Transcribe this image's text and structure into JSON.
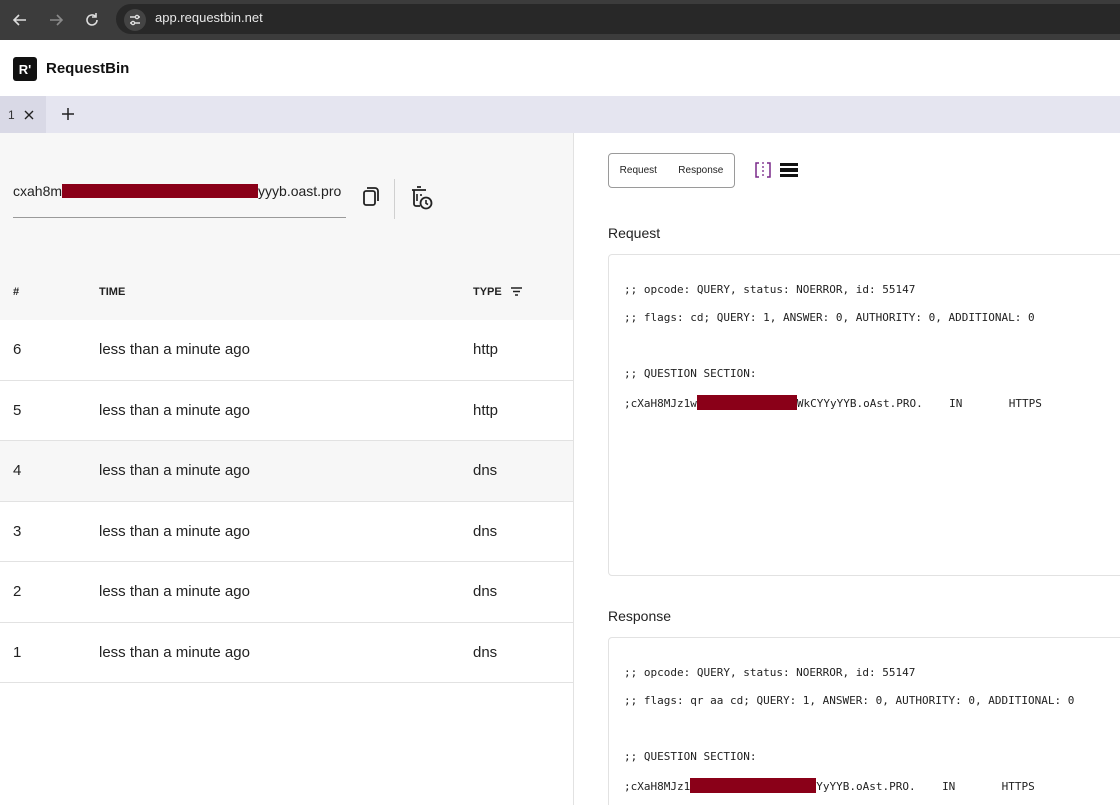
{
  "browser": {
    "url": "app.requestbin.net",
    "back_icon": "arrow-left-icon",
    "forward_icon": "arrow-right-icon",
    "reload_icon": "reload-icon",
    "site_info_icon": "tune-icon"
  },
  "app": {
    "logo_text": "R'",
    "brand": "RequestBin"
  },
  "tabs": [
    {
      "label": "1",
      "close_icon": "close-icon"
    }
  ],
  "endpoint": {
    "prefix": "cxah8m",
    "suffix": "yyyb.oast.pro",
    "redacted": true
  },
  "table": {
    "headers": {
      "num": "#",
      "time": "TIME",
      "type": "TYPE"
    },
    "filter_icon": "filter-icon",
    "rows": [
      {
        "num": "6",
        "time": "less than a minute ago",
        "type": "http"
      },
      {
        "num": "5",
        "time": "less than a minute ago",
        "type": "http"
      },
      {
        "num": "4",
        "time": "less than a minute ago",
        "type": "dns"
      },
      {
        "num": "3",
        "time": "less than a minute ago",
        "type": "dns"
      },
      {
        "num": "2",
        "time": "less than a minute ago",
        "type": "dns"
      },
      {
        "num": "1",
        "time": "less than a minute ago",
        "type": "dns"
      }
    ]
  },
  "view_toggle": {
    "request": "Request",
    "response": "Response"
  },
  "request": {
    "title": "Request",
    "line1": ";; opcode: QUERY, status: NOERROR, id: 55147",
    "line2": ";; flags: cd; QUERY: 1, ANSWER: 0, AUTHORITY: 0, ADDITIONAL: 0",
    "line3": ";; QUESTION SECTION:",
    "q_prefix": ";cXaH8MJz1w",
    "q_suffix": "WkCYYyYYB.oAst.PRO.    IN       HTTPS"
  },
  "response": {
    "title": "Response",
    "line1": ";; opcode: QUERY, status: NOERROR, id: 55147",
    "line2": ";; flags: qr aa cd; QUERY: 1, ANSWER: 0, AUTHORITY: 0, ADDITIONAL: 0",
    "line3": ";; QUESTION SECTION:",
    "q_prefix": ";cXaH8MJz1",
    "q_suffix": "YyYYB.oAst.PRO.    IN       HTTPS"
  },
  "colors": {
    "redaction": "#8a0018",
    "browser_bar": "#3c3c3c",
    "tab_bar": "#e5e5f0",
    "accent_purple": "#7a2a8a"
  }
}
